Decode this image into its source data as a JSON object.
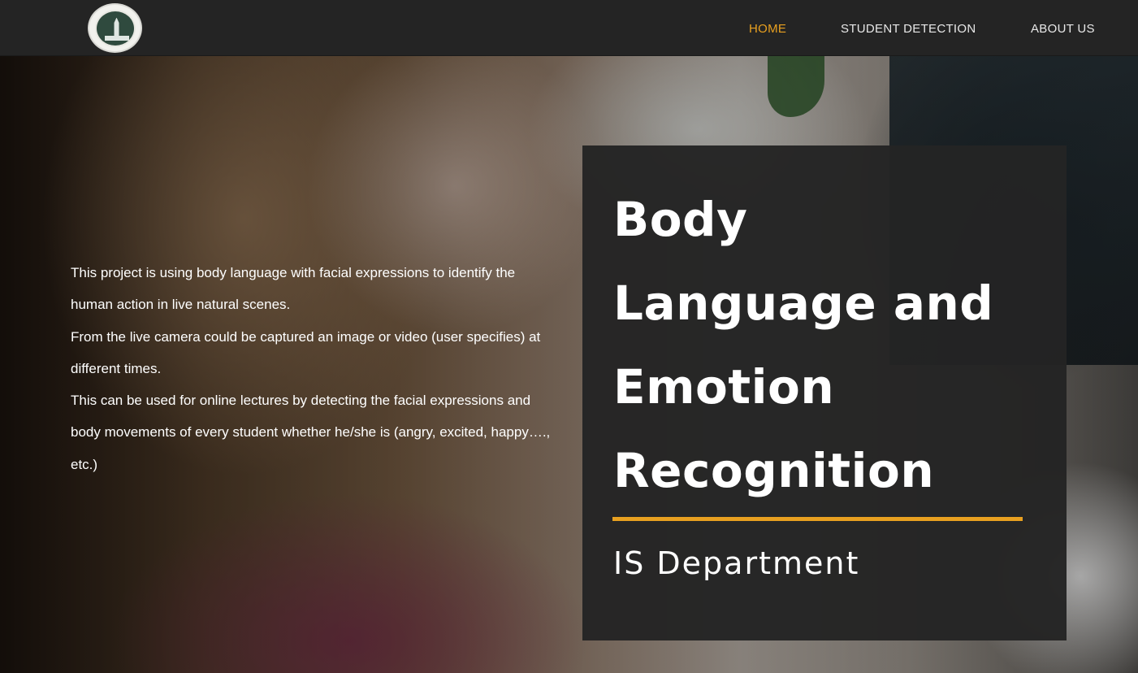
{
  "navbar": {
    "logo_icon": "university-seal-icon",
    "links": [
      {
        "label": "HOME",
        "active": true
      },
      {
        "label": "STUDENT DETECTION",
        "active": false
      },
      {
        "label": "ABOUT US",
        "active": false
      }
    ]
  },
  "hero": {
    "description": [
      "This project is using body language with facial expressions to identify the human action in live natural scenes.",
      "From the live camera could be captured an image or video (user specifies) at different times.",
      "This can be used for online lectures by detecting the facial expressions and body movements of every student whether he/she is (angry, excited, happy…., etc.)"
    ],
    "title_lines": [
      "Body",
      "Language and",
      "Emotion",
      "Recognition"
    ],
    "subtitle": "IS Department"
  },
  "colors": {
    "accent": "#e8a020",
    "navbar_bg": "#242424",
    "card_bg": "#242424",
    "text": "#ffffff"
  }
}
